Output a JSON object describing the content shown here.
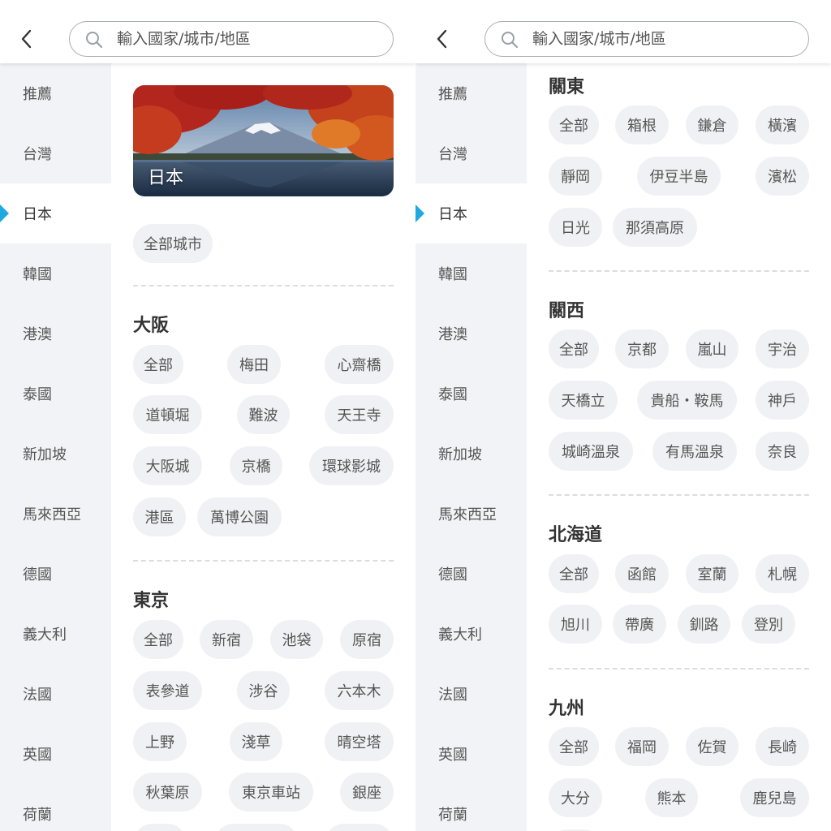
{
  "search": {
    "placeholder": "輸入國家/城市/地區"
  },
  "sidebar": {
    "items": [
      "推薦",
      "台灣",
      "日本",
      "韓國",
      "港澳",
      "泰國",
      "新加坡",
      "馬來西亞",
      "德國",
      "義大利",
      "法國",
      "英國",
      "荷蘭"
    ],
    "active": "日本"
  },
  "colors": {
    "accent": "#1ea9e1",
    "sidebar_bg": "#f2f3f6",
    "chip_bg": "#f0f1f4"
  },
  "left_panel": {
    "banner_title": "日本",
    "all_cities": "全部城市",
    "osaka": {
      "title": "大阪",
      "chips": [
        "全部",
        "梅田",
        "心齋橋",
        "道頓堀",
        "難波",
        "天王寺",
        "大阪城",
        "京橋",
        "環球影城",
        "港區",
        "萬博公園"
      ]
    },
    "tokyo": {
      "title": "東京",
      "chips": [
        "全部",
        "新宿",
        "池袋",
        "原宿",
        "表參道",
        "涉谷",
        "六本木",
        "上野",
        "淺草",
        "晴空塔",
        "秋葉原",
        "東京車站",
        "銀座"
      ]
    }
  },
  "right_panel": {
    "kanto": {
      "title": "關東",
      "chips": [
        "全部",
        "箱根",
        "鎌倉",
        "橫濱",
        "靜岡",
        "伊豆半島",
        "濱松",
        "日光",
        "那須高原"
      ]
    },
    "kansai": {
      "title": "關西",
      "chips": [
        "全部",
        "京都",
        "嵐山",
        "宇治",
        "天橋立",
        "貴船・鞍馬",
        "神戶",
        "城崎溫泉",
        "有馬溫泉",
        "奈良"
      ]
    },
    "hokkaido": {
      "title": "北海道",
      "chips": [
        "全部",
        "函館",
        "室蘭",
        "札幌",
        "旭川",
        "帶廣",
        "釧路",
        "登別"
      ]
    },
    "kyushu": {
      "title": "九州",
      "chips": [
        "全部",
        "福岡",
        "佐賀",
        "長崎",
        "大分",
        "熊本",
        "鹿兒島"
      ]
    }
  }
}
